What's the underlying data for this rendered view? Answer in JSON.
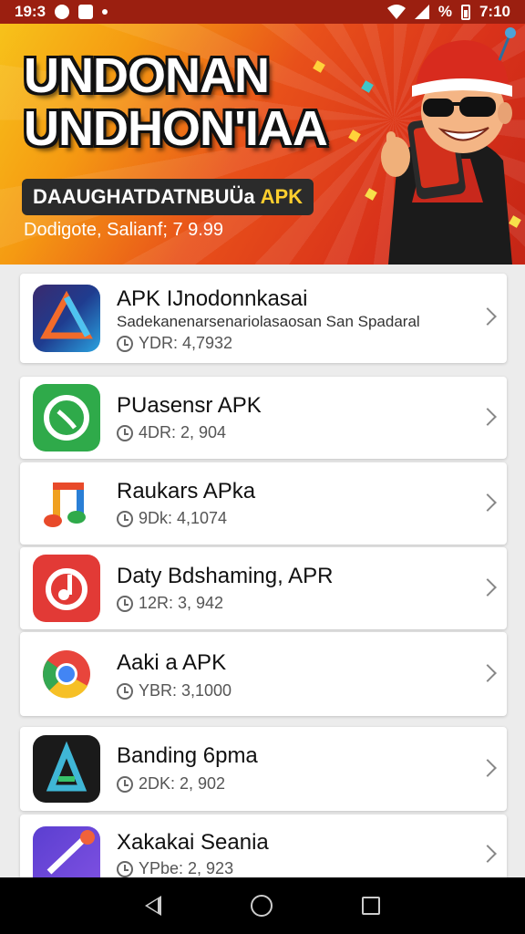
{
  "status_bar": {
    "time_left": "19:3",
    "battery_pct": "%",
    "time_right": "7:10"
  },
  "banner": {
    "title_line1": "UNDONAN",
    "title_line2": "UNDHON'IAA",
    "pill_text": "DAAUGHATDATNBUÜa",
    "pill_apk": "APK",
    "subtitle": "Dodigote, Salianf; 7 9.99"
  },
  "apps": [
    {
      "name": "APK IJnodonnkasai",
      "desc": "Sadekanenarsenariolasaosan San Spadaral",
      "meta": "YDR: 4,7932",
      "icon": "triangle-app-icon"
    },
    {
      "name": "PUasensr APK",
      "desc": "",
      "meta": "4DR: 2, 904",
      "icon": "chat-app-icon"
    },
    {
      "name": "Raukars APka",
      "desc": "",
      "meta": "9Dk: 4,1074",
      "icon": "music-note-icon"
    },
    {
      "name": "Daty Bdshaming, APR",
      "desc": "",
      "meta": "12R: 3, 942",
      "icon": "music-app-icon"
    },
    {
      "name": "Aaki a APK",
      "desc": "",
      "meta": "YBR: 3,1000",
      "icon": "chrome-icon"
    },
    {
      "name": "Banding 6pma",
      "desc": "",
      "meta": "2DK: 2, 902",
      "icon": "art-app-icon"
    },
    {
      "name": "Xakakai Seania",
      "desc": "",
      "meta": "YPbe: 2, 923",
      "icon": "brush-app-icon"
    }
  ],
  "colors": {
    "banner_red": "#d9321a",
    "banner_yellow": "#f7c21a",
    "pill_apk": "#ffcf2e"
  }
}
